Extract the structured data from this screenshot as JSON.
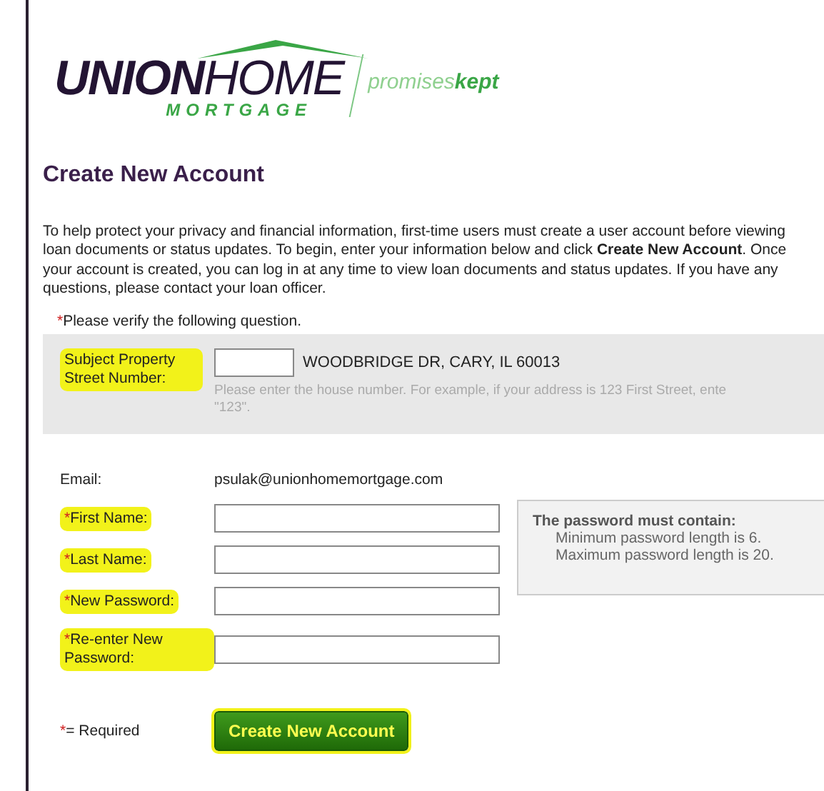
{
  "logo": {
    "brand_bold": "UNION",
    "brand_light": "HOME",
    "sub": "MORTGAGE",
    "tagline_light": "promises",
    "tagline_bold": "kept"
  },
  "title": "Create New Account",
  "intro": "To help protect your privacy and financial information, first-time users must create a user account before viewing loan documents or status updates. To begin, enter your information below and click **Create New Account**. Once your account is created, you can log in at any time to view loan documents and status updates. If you have any questions, please contact your loan officer.",
  "verify": {
    "mark": "*",
    "text": "Please verify the following question."
  },
  "street": {
    "label": "Subject Property Street Number:",
    "highlighted": true,
    "address": "WOODBRIDGE DR, CARY, IL 60013",
    "hint_lines": [
      "Please enter the house number. For example, if your address is 123 First Street, ente",
      "\"123\"."
    ]
  },
  "email": {
    "label": "Email:",
    "value": "psulak@unionhomemortgage.com"
  },
  "fields": [
    {
      "label": "First Name:",
      "required": true,
      "highlighted": true
    },
    {
      "label": "Last Name:",
      "required": true,
      "highlighted": true
    },
    {
      "label": "New Password:",
      "required": true,
      "highlighted": true
    },
    {
      "label": "Re-enter New Password:",
      "required": true,
      "highlighted": true
    }
  ],
  "password_rules": {
    "heading": "The password must contain:",
    "rules": [
      "Minimum password length is 6.",
      "Maximum password length is 20."
    ]
  },
  "legend": {
    "mark": "*",
    "text": "= Required"
  },
  "submit": {
    "label": "Create New Account",
    "highlighted": true
  }
}
